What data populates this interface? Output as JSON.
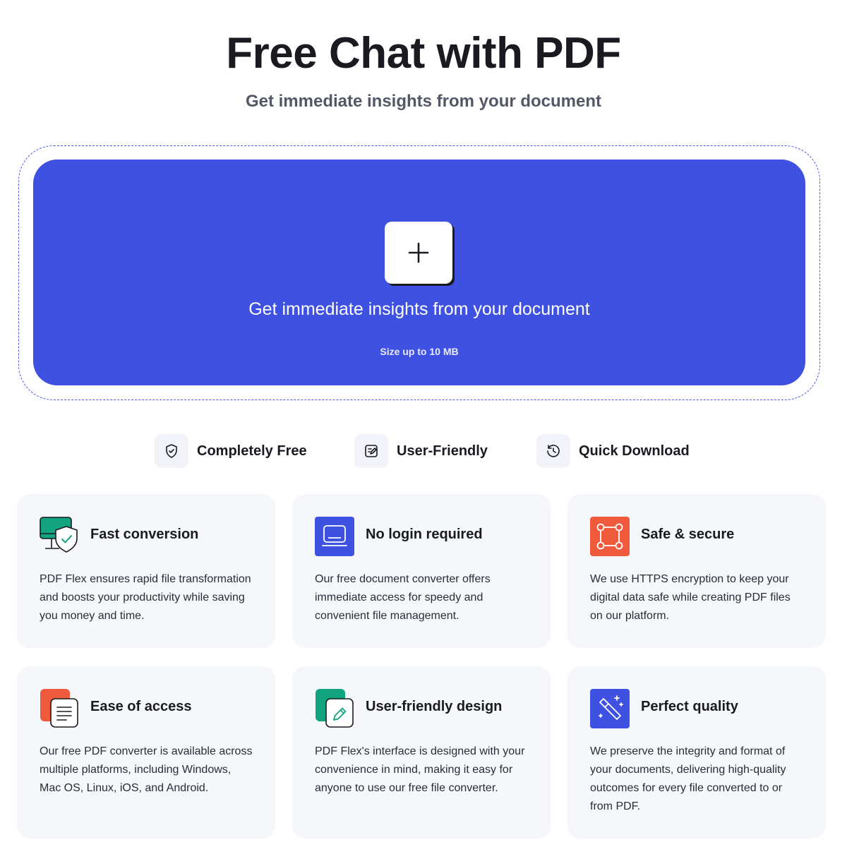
{
  "header": {
    "title": "Free Chat with PDF",
    "subtitle": "Get immediate insights from your document"
  },
  "upload": {
    "prompt": "Get immediate insights from your document",
    "limit": "Size up to 10 MB",
    "button_icon": "plus-icon",
    "accent_color": "#3f51e0"
  },
  "perks": [
    {
      "label": "Completely Free",
      "icon": "shield-check-icon"
    },
    {
      "label": "User-Friendly",
      "icon": "edit-note-icon"
    },
    {
      "label": "Quick Download",
      "icon": "history-clock-icon"
    }
  ],
  "features": [
    {
      "title": "Fast conversion",
      "icon": "monitor-shield-icon",
      "description": "PDF Flex ensures rapid file transformation and boosts your productivity while saving you money and time."
    },
    {
      "title": "No login required",
      "icon": "laptop-icon",
      "description": "Our free document converter offers immediate access for speedy and convenient file management."
    },
    {
      "title": "Safe & secure",
      "icon": "nodes-square-icon",
      "description": "We use HTTPS encryption to keep your digital data safe while creating PDF files on our platform."
    },
    {
      "title": "Ease of access",
      "icon": "document-lines-icon",
      "description": "Our free PDF converter is available across multiple platforms, including Windows, Mac OS, Linux, iOS, and Android."
    },
    {
      "title": "User-friendly design",
      "icon": "pencil-icon",
      "description": "PDF Flex's interface is designed with your convenience in mind, making it easy for anyone to use our free file converter."
    },
    {
      "title": "Perfect quality",
      "icon": "magic-wand-icon",
      "description": "We preserve the integrity and format of your documents, delivering high-quality outcomes for every file converted to or from PDF."
    }
  ],
  "colors": {
    "green": "#12a37f",
    "blue": "#3f51e0",
    "orange": "#f05a3c"
  }
}
